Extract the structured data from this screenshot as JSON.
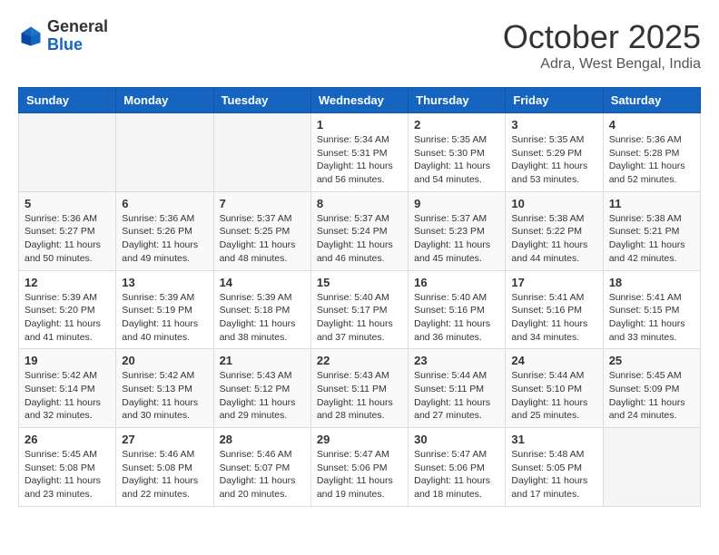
{
  "header": {
    "logo_general": "General",
    "logo_blue": "Blue",
    "month_title": "October 2025",
    "location": "Adra, West Bengal, India"
  },
  "weekdays": [
    "Sunday",
    "Monday",
    "Tuesday",
    "Wednesday",
    "Thursday",
    "Friday",
    "Saturday"
  ],
  "weeks": [
    [
      {
        "day": "",
        "info": ""
      },
      {
        "day": "",
        "info": ""
      },
      {
        "day": "",
        "info": ""
      },
      {
        "day": "1",
        "info": "Sunrise: 5:34 AM\nSunset: 5:31 PM\nDaylight: 11 hours\nand 56 minutes."
      },
      {
        "day": "2",
        "info": "Sunrise: 5:35 AM\nSunset: 5:30 PM\nDaylight: 11 hours\nand 54 minutes."
      },
      {
        "day": "3",
        "info": "Sunrise: 5:35 AM\nSunset: 5:29 PM\nDaylight: 11 hours\nand 53 minutes."
      },
      {
        "day": "4",
        "info": "Sunrise: 5:36 AM\nSunset: 5:28 PM\nDaylight: 11 hours\nand 52 minutes."
      }
    ],
    [
      {
        "day": "5",
        "info": "Sunrise: 5:36 AM\nSunset: 5:27 PM\nDaylight: 11 hours\nand 50 minutes."
      },
      {
        "day": "6",
        "info": "Sunrise: 5:36 AM\nSunset: 5:26 PM\nDaylight: 11 hours\nand 49 minutes."
      },
      {
        "day": "7",
        "info": "Sunrise: 5:37 AM\nSunset: 5:25 PM\nDaylight: 11 hours\nand 48 minutes."
      },
      {
        "day": "8",
        "info": "Sunrise: 5:37 AM\nSunset: 5:24 PM\nDaylight: 11 hours\nand 46 minutes."
      },
      {
        "day": "9",
        "info": "Sunrise: 5:37 AM\nSunset: 5:23 PM\nDaylight: 11 hours\nand 45 minutes."
      },
      {
        "day": "10",
        "info": "Sunrise: 5:38 AM\nSunset: 5:22 PM\nDaylight: 11 hours\nand 44 minutes."
      },
      {
        "day": "11",
        "info": "Sunrise: 5:38 AM\nSunset: 5:21 PM\nDaylight: 11 hours\nand 42 minutes."
      }
    ],
    [
      {
        "day": "12",
        "info": "Sunrise: 5:39 AM\nSunset: 5:20 PM\nDaylight: 11 hours\nand 41 minutes."
      },
      {
        "day": "13",
        "info": "Sunrise: 5:39 AM\nSunset: 5:19 PM\nDaylight: 11 hours\nand 40 minutes."
      },
      {
        "day": "14",
        "info": "Sunrise: 5:39 AM\nSunset: 5:18 PM\nDaylight: 11 hours\nand 38 minutes."
      },
      {
        "day": "15",
        "info": "Sunrise: 5:40 AM\nSunset: 5:17 PM\nDaylight: 11 hours\nand 37 minutes."
      },
      {
        "day": "16",
        "info": "Sunrise: 5:40 AM\nSunset: 5:16 PM\nDaylight: 11 hours\nand 36 minutes."
      },
      {
        "day": "17",
        "info": "Sunrise: 5:41 AM\nSunset: 5:16 PM\nDaylight: 11 hours\nand 34 minutes."
      },
      {
        "day": "18",
        "info": "Sunrise: 5:41 AM\nSunset: 5:15 PM\nDaylight: 11 hours\nand 33 minutes."
      }
    ],
    [
      {
        "day": "19",
        "info": "Sunrise: 5:42 AM\nSunset: 5:14 PM\nDaylight: 11 hours\nand 32 minutes."
      },
      {
        "day": "20",
        "info": "Sunrise: 5:42 AM\nSunset: 5:13 PM\nDaylight: 11 hours\nand 30 minutes."
      },
      {
        "day": "21",
        "info": "Sunrise: 5:43 AM\nSunset: 5:12 PM\nDaylight: 11 hours\nand 29 minutes."
      },
      {
        "day": "22",
        "info": "Sunrise: 5:43 AM\nSunset: 5:11 PM\nDaylight: 11 hours\nand 28 minutes."
      },
      {
        "day": "23",
        "info": "Sunrise: 5:44 AM\nSunset: 5:11 PM\nDaylight: 11 hours\nand 27 minutes."
      },
      {
        "day": "24",
        "info": "Sunrise: 5:44 AM\nSunset: 5:10 PM\nDaylight: 11 hours\nand 25 minutes."
      },
      {
        "day": "25",
        "info": "Sunrise: 5:45 AM\nSunset: 5:09 PM\nDaylight: 11 hours\nand 24 minutes."
      }
    ],
    [
      {
        "day": "26",
        "info": "Sunrise: 5:45 AM\nSunset: 5:08 PM\nDaylight: 11 hours\nand 23 minutes."
      },
      {
        "day": "27",
        "info": "Sunrise: 5:46 AM\nSunset: 5:08 PM\nDaylight: 11 hours\nand 22 minutes."
      },
      {
        "day": "28",
        "info": "Sunrise: 5:46 AM\nSunset: 5:07 PM\nDaylight: 11 hours\nand 20 minutes."
      },
      {
        "day": "29",
        "info": "Sunrise: 5:47 AM\nSunset: 5:06 PM\nDaylight: 11 hours\nand 19 minutes."
      },
      {
        "day": "30",
        "info": "Sunrise: 5:47 AM\nSunset: 5:06 PM\nDaylight: 11 hours\nand 18 minutes."
      },
      {
        "day": "31",
        "info": "Sunrise: 5:48 AM\nSunset: 5:05 PM\nDaylight: 11 hours\nand 17 minutes."
      },
      {
        "day": "",
        "info": ""
      }
    ]
  ]
}
